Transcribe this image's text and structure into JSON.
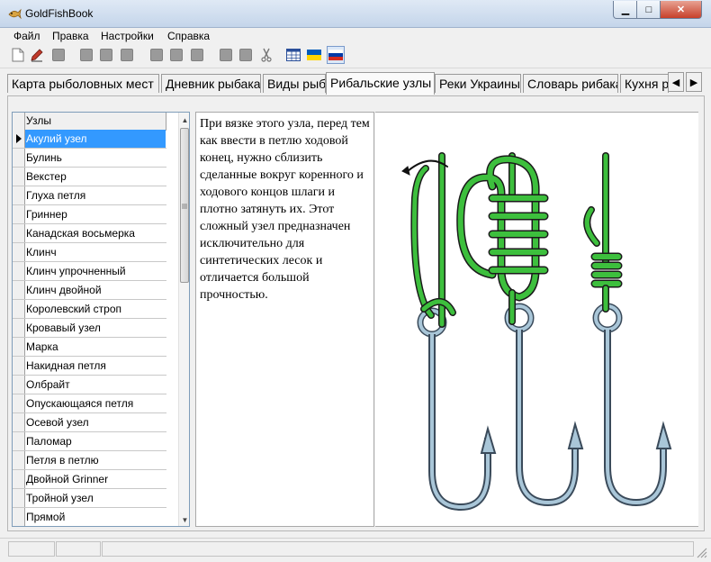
{
  "window": {
    "title": "GoldFishBook",
    "min_glyph": "▁",
    "max_glyph": "□",
    "close_glyph": "✕"
  },
  "menu": [
    "Файл",
    "Правка",
    "Настройки",
    "Справка"
  ],
  "tabs": [
    {
      "label": "Карта рыболовных мест"
    },
    {
      "label": "Дневник рыбака"
    },
    {
      "label": "Виды рыб"
    },
    {
      "label": "Рибальские узлы",
      "active": true
    },
    {
      "label": "Реки Украины"
    },
    {
      "label": "Словарь рибака"
    },
    {
      "label": "Кухня р"
    }
  ],
  "tab_scroll": {
    "left": "◀",
    "right": "▶"
  },
  "grid": {
    "column_header": "Узлы",
    "selected_index": 0,
    "rows": [
      "Акулий узел",
      "Булинь",
      "Векстер",
      "Глуха петля",
      "Гриннер",
      "Канадская восьмерка",
      "Клинч",
      "Клинч упрочненный",
      "Клинч двойной",
      "Королевский строп",
      "Кровавый узел",
      "Марка",
      "Накидная петля",
      "Олбрайт",
      "Опускающаяся петля",
      "Осевой узел",
      "Паломар",
      "Петля в петлю",
      "Двойной Grinner",
      "Тройной узел",
      "Прямой"
    ],
    "scroll_up": "▲",
    "scroll_down": "▼"
  },
  "description": "При вязке этого узла, перед тем как ввести в петлю ходовой конец, нужно сблизить сделанные вокруг коренного и ходового концов шлаги и плотно затянуть их. Этот сложный узел предназначен исключительно для синтетических лесок и отличается большой прочностью.",
  "colors": {
    "accent": "#3399ff",
    "knot_green": "#3dbf3d",
    "hook_blue": "#a9c6d8",
    "flag_ua_blue": "#005bbb",
    "flag_ua_yellow": "#ffd500"
  }
}
